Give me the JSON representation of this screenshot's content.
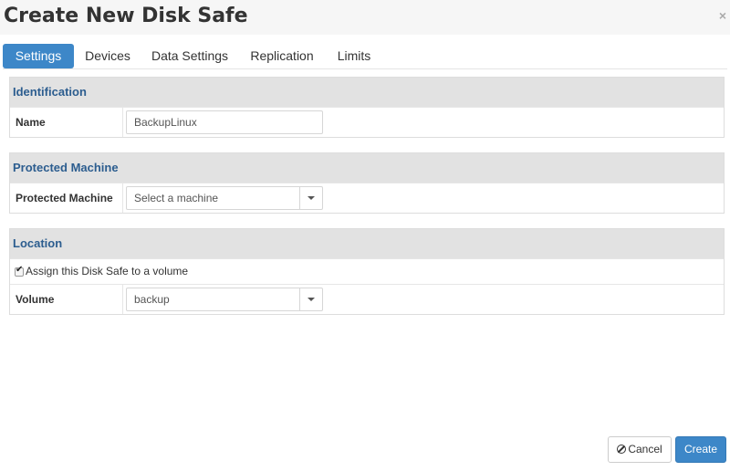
{
  "dialog": {
    "title": "Create New Disk Safe",
    "close_label": "×"
  },
  "tabs": [
    {
      "label": "Settings",
      "active": true
    },
    {
      "label": "Devices",
      "active": false
    },
    {
      "label": "Data Settings",
      "active": false
    },
    {
      "label": "Replication",
      "active": false
    },
    {
      "label": "Limits",
      "active": false
    }
  ],
  "identification": {
    "header": "Identification",
    "name_label": "Name",
    "name_value": "BackupLinux"
  },
  "protected_machine": {
    "header": "Protected Machine",
    "label": "Protected Machine",
    "selected": "Select a machine"
  },
  "location": {
    "header": "Location",
    "assign_label": "Assign this Disk Safe to a volume",
    "assign_checked": true,
    "volume_label": "Volume",
    "volume_selected": "backup"
  },
  "footer": {
    "cancel_label": "Cancel",
    "create_label": "Create"
  },
  "colors": {
    "accent": "#3d87c8",
    "section_title": "#2c5d8f",
    "section_header_bg": "#e2e2e2"
  },
  "icons": {
    "close": "close-icon",
    "cancel": "ban-icon",
    "dropdown": "chevron-down-icon",
    "check": "check-icon"
  }
}
